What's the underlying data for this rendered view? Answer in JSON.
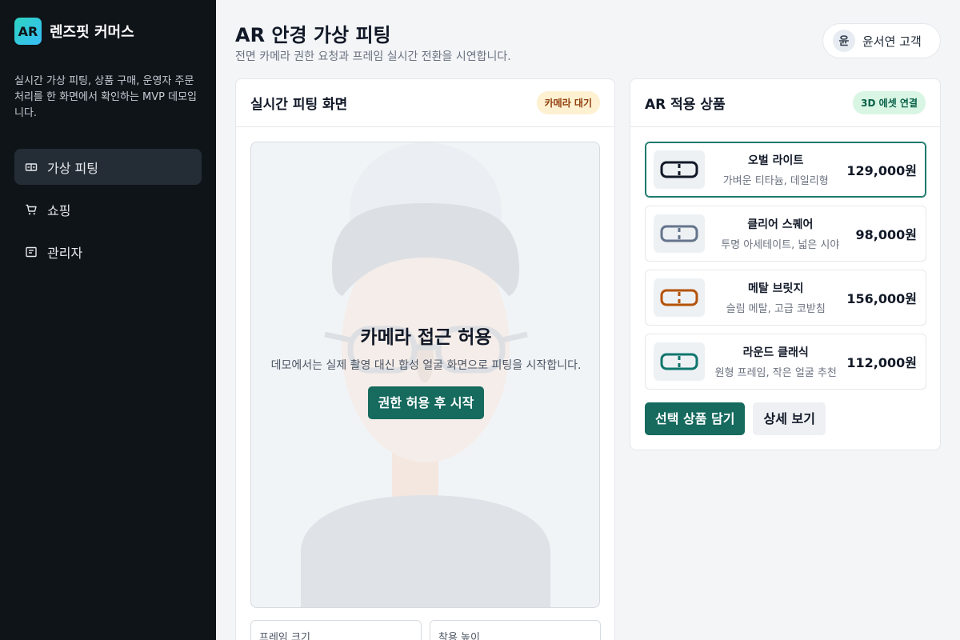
{
  "brand": {
    "logo_text": "AR",
    "name": "렌즈핏 커머스"
  },
  "sidebar": {
    "description": "실시간 가상 피팅, 상품 구매, 운영자 주문 처리를 한 화면에서 확인하는 MVP 데모입니다.",
    "items": [
      {
        "label": "가상 피팅",
        "icon": "glasses-icon",
        "active": true
      },
      {
        "label": "쇼핑",
        "icon": "cart-icon",
        "active": false
      },
      {
        "label": "관리자",
        "icon": "admin-icon",
        "active": false
      }
    ]
  },
  "header": {
    "title": "AR 안경 가상 피팅",
    "subtitle": "전면 카메라 권한 요청과 프레임 실시간 전환을 시연합니다."
  },
  "user": {
    "avatar": "윤",
    "name": "윤서연 고객"
  },
  "fitting": {
    "title": "실시간 피팅 화면",
    "badge": "카메라 대기",
    "overlay_title": "카메라 접근 허용",
    "overlay_desc": "데모에서는 실제 촬영 대신 합성 얼굴 화면으로 피팅을 시작합니다.",
    "start_button": "권한 허용 후 시작",
    "controls": [
      {
        "label": "프레임 크기"
      },
      {
        "label": "착용 높이"
      }
    ]
  },
  "ar_products": {
    "title": "AR 적용 상품",
    "badge": "3D 에셋 연결",
    "items": [
      {
        "name": "오벌 라이트",
        "desc": "가벼운 티타늄, 데일리형",
        "price": "129,000원",
        "color": "#111827",
        "selected": true
      },
      {
        "name": "클리어 스퀘어",
        "desc": "투명 아세테이트, 넓은 시야",
        "price": "98,000원",
        "color": "#64748b",
        "selected": false
      },
      {
        "name": "메탈 브릿지",
        "desc": "슬림 메탈, 고급 코받침",
        "price": "156,000원",
        "color": "#b45309",
        "selected": false
      },
      {
        "name": "라운드 클래식",
        "desc": "원형 프레임, 작은 얼굴 추천",
        "price": "112,000원",
        "color": "#0f766e",
        "selected": false
      }
    ],
    "add_button": "선택 상품 담기",
    "detail_button": "상세 보기"
  },
  "colors": {
    "accent": "#166a5e",
    "sidebar_bg": "#0f1419",
    "page_bg": "#f3f5f7"
  }
}
